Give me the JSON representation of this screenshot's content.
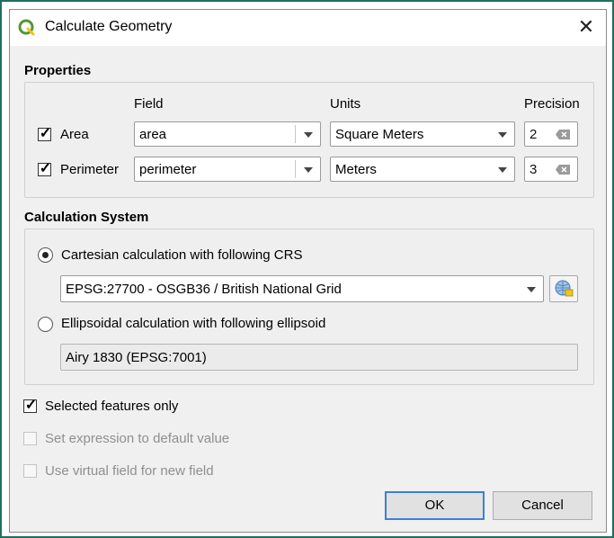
{
  "window": {
    "title": "Calculate Geometry"
  },
  "properties": {
    "section_title": "Properties",
    "headers": {
      "field": "Field",
      "units": "Units",
      "precision": "Precision"
    },
    "rows": [
      {
        "label": "Area",
        "checked": true,
        "field": "area",
        "units": "Square Meters",
        "precision": "2"
      },
      {
        "label": "Perimeter",
        "checked": true,
        "field": "perimeter",
        "units": "Meters",
        "precision": "3"
      }
    ]
  },
  "calc_system": {
    "section_title": "Calculation System",
    "cartesian_label": "Cartesian calculation with following CRS",
    "cartesian_selected": true,
    "crs_value": "EPSG:27700 - OSGB36 / British National Grid",
    "ellipsoidal_label": "Ellipsoidal calculation with following ellipsoid",
    "ellipsoidal_selected": false,
    "ellipsoid_value": "Airy 1830 (EPSG:7001)"
  },
  "options": {
    "selected_only": {
      "label": "Selected features only",
      "checked": true,
      "enabled": true
    },
    "default_value": {
      "label": "Set expression to default value",
      "checked": false,
      "enabled": false
    },
    "virtual_field": {
      "label": "Use virtual field for new field",
      "checked": false,
      "enabled": false
    }
  },
  "buttons": {
    "ok": "OK",
    "cancel": "Cancel"
  },
  "colors": {
    "accent": "#3c7fd6",
    "frame": "#1f6f5f",
    "qgis_green": "#589632"
  },
  "icons": [
    "qgis-logo-icon",
    "close-icon",
    "checkmark-icon",
    "chevron-down-icon",
    "clear-icon",
    "globe-crs-icon"
  ]
}
